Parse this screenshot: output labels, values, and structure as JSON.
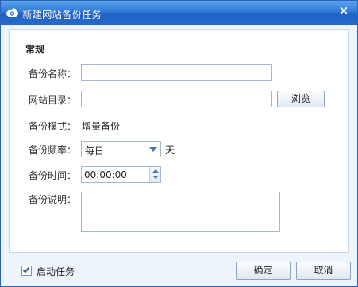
{
  "window": {
    "title": "新建网站备份任务",
    "close_symbol": "×"
  },
  "section": {
    "title": "常规"
  },
  "form": {
    "name_label": "备份名称：",
    "name_value": "",
    "dir_label": "网站目录：",
    "dir_value": "",
    "browse_label": "浏览",
    "mode_label": "备份模式：",
    "mode_value": "增量备份",
    "freq_label": "备份频率：",
    "freq_value": "每日",
    "freq_unit": "天",
    "time_label": "备份时间：",
    "time_value": "00:00:00",
    "desc_label": "备份说明：",
    "desc_value": ""
  },
  "footer": {
    "enable_label": "启动任务",
    "enable_checked": true,
    "ok_label": "确定",
    "cancel_label": "取消"
  },
  "icons": {
    "title_icon": "cloud-icon",
    "close_icon": "close-icon",
    "dropdown_icon": "chevron-down-icon",
    "spinner_up": "spin-up-icon",
    "spinner_down": "spin-down-icon",
    "checkbox_icon": "checkmark-icon"
  },
  "colors": {
    "titlebar": "#2f78d8",
    "window_bg": "#eef4fb",
    "accent": "#4a74b0"
  }
}
